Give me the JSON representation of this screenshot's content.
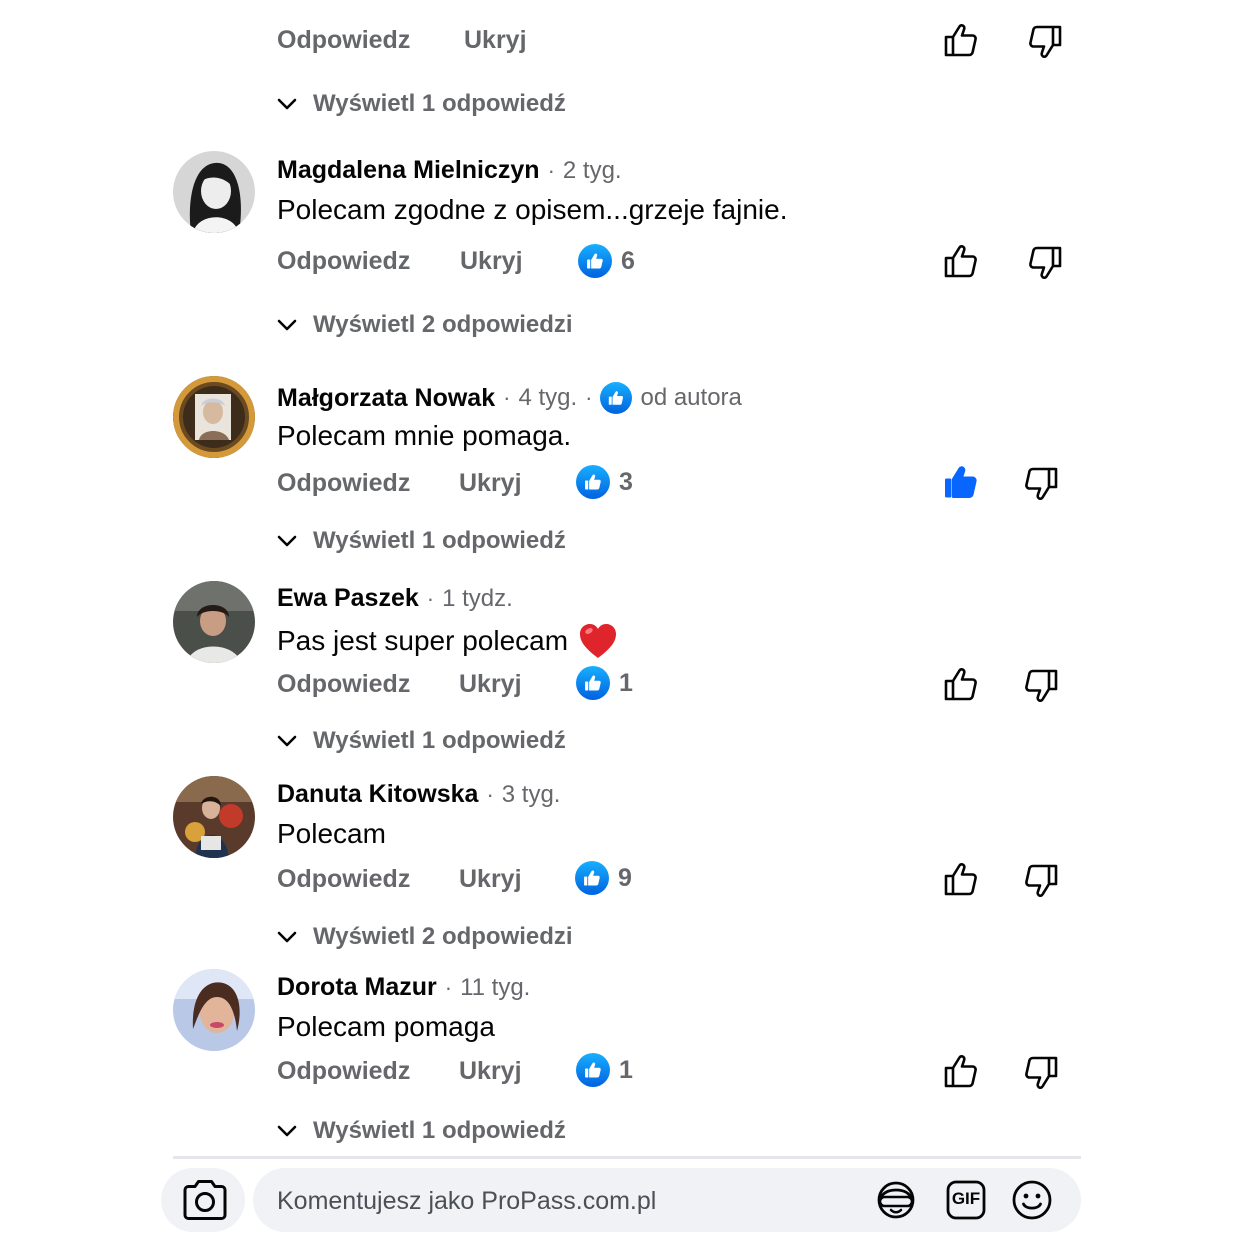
{
  "actions": {
    "reply_label": "Odpowiedz",
    "hide_label": "Ukryj"
  },
  "top_partial": {
    "view_replies": "Wyświetl 1 odpowiedź"
  },
  "comments": [
    {
      "author": "Magdalena Mielniczyn",
      "time": "2 tyg.",
      "text": "Polecam zgodne z opisem...grzeje fajnie.",
      "reactions": "6",
      "view_replies": "Wyświetl 2 odpowiedzi",
      "liked": false
    },
    {
      "author": "Małgorzata Nowak",
      "time": "4 tyg.",
      "author_badge": "od autora",
      "text": "Polecam mnie pomaga.",
      "reactions": "3",
      "view_replies": "Wyświetl 1 odpowiedź",
      "liked": true
    },
    {
      "author": "Ewa Paszek",
      "time": "1 tydz.",
      "text": "Pas jest super polecam",
      "emoji": "❤️",
      "reactions": "1",
      "view_replies": "Wyświetl 1 odpowiedź",
      "liked": false
    },
    {
      "author": "Danuta Kitowska",
      "time": "3 tyg.",
      "text": "Polecam",
      "reactions": "9",
      "view_replies": "Wyświetl 2 odpowiedzi",
      "liked": false
    },
    {
      "author": "Dorota Mazur",
      "time": "11 tyg.",
      "text": "Polecam pomaga",
      "reactions": "1",
      "view_replies": "Wyświetl 1 odpowiedź",
      "liked": false
    }
  ],
  "composer": {
    "placeholder": "Komentujesz jako ProPass.com.pl",
    "gif_label": "GIF",
    "icons": [
      "camera-icon",
      "avatar-sticker-icon",
      "gif-icon",
      "emoji-icon"
    ]
  },
  "colors": {
    "accent": "#0866ff",
    "secondary_text": "#65676b",
    "composer_bg": "#f0f2f5"
  }
}
